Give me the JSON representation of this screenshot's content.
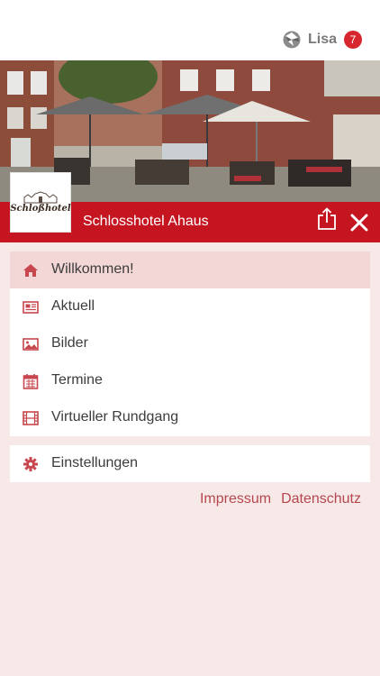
{
  "user": {
    "name": "Lisa",
    "badge_count": "7",
    "icon": "user-app-icon"
  },
  "header": {
    "title": "Schlosshotel Ahaus",
    "logo_text": "Schloßhotel"
  },
  "menu": [
    {
      "label": "Willkommen!",
      "icon": "home-icon",
      "active": true
    },
    {
      "label": "Aktuell",
      "icon": "newspaper-icon",
      "active": false
    },
    {
      "label": "Bilder",
      "icon": "image-icon",
      "active": false
    },
    {
      "label": "Termine",
      "icon": "calendar-icon",
      "active": false
    },
    {
      "label": "Virtueller Rundgang",
      "icon": "film-icon",
      "active": false
    }
  ],
  "settings": {
    "label": "Einstellungen",
    "icon": "gear-icon"
  },
  "footer": {
    "impressum": "Impressum",
    "datenschutz": "Datenschutz"
  },
  "colors": {
    "accent": "#c41521",
    "icon": "#c8474e",
    "active_bg": "#f3d6d6",
    "page_bg": "#f8e9e9"
  }
}
